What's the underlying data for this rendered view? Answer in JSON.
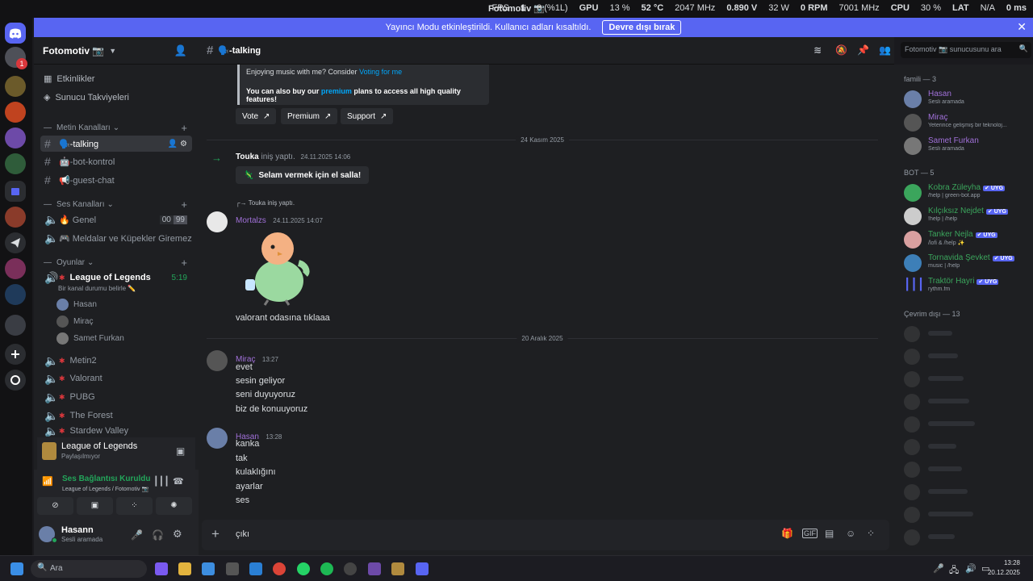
{
  "window": {
    "title": "Fotomotiv 📷",
    "stats": [
      "FPS",
      "1",
      "0 (%1L)",
      "GPU",
      "13 %",
      "52 °C",
      "2047 MHz",
      "0.890 V",
      "32 W",
      "0 RPM",
      "7001 MHz",
      "CPU",
      "30 %",
      "LAT",
      "N/A",
      "0 ms"
    ]
  },
  "banner": {
    "text": "Yayıncı Modu etkinleştirildi. Kullanıcı adları kısaltıldı.",
    "button": "Devre dışı bırak"
  },
  "rail": {
    "badge": "1"
  },
  "sidebar": {
    "guild_name": "Fotomotiv 📷",
    "nav": [
      "Etkinlikler",
      "Sunucu Takviyeleri"
    ],
    "text_category": "Metin Kanalları",
    "text_channels": [
      "🗣️-talking",
      "🤖-bot-kontrol",
      "📢-guest-chat"
    ],
    "voice_category": "Ses Kanalları",
    "voice_channels": [
      {
        "name": "🔥 Genel",
        "badge1": "00",
        "badge2": "99"
      },
      {
        "name": "🎮 Meldalar ve Küpekler Giremez"
      }
    ],
    "games_category": "Oyunlar",
    "active_channel": {
      "name": "League of Legends",
      "time": "5:19",
      "status": "Bir kanal durumu belirle ✏️"
    },
    "voice_members": [
      "Hasan",
      "Miraç",
      "Samet Furkan"
    ],
    "game_channels": [
      "Metin2",
      "Valorant",
      "PUBG",
      "The Forest",
      "Stardew Valley"
    ]
  },
  "activity": {
    "title": "League of Legends",
    "subtitle": "Paylaşılmıyor"
  },
  "voice": {
    "status": "Ses Bağlantısı Kuruldu",
    "location": "League of Legends / Fotomotiv 📷"
  },
  "user": {
    "name": "Hasann",
    "status": "Sesli aramada"
  },
  "chat": {
    "channel": "🗣️-talking",
    "embed": {
      "line1_prefix": "Enjoying music with me? Consider ",
      "line1_link": "Voting for me",
      "line2_prefix": "You can also buy our ",
      "line2_link": "premium",
      "line2_suffix": " plans to access all high quality features!",
      "buttons": [
        "Vote",
        "Premium",
        "Support"
      ]
    },
    "divider1": "24 Kasım 2025",
    "join_user": "Touka",
    "join_text": "iniş yaptı.",
    "join_time": "24.11.2025 14:06",
    "wave_button": "Selam vermek için el salla!",
    "reply_ref": "Touka iniş yaptı.",
    "msg1_user": "Mortalzs",
    "msg1_time": "24.11.2025 14:07",
    "msg1_text": "valorant odasına tıklaaa",
    "divider2": "20 Aralık 2025",
    "msg2_user": "Miraç",
    "msg2_time": "13:27",
    "msg2_lines": [
      "evet",
      "sesin geliyor",
      "seni duyuyoruz",
      "biz de konuuyoruz"
    ],
    "msg3_user": "Hasan",
    "msg3_time": "13:28",
    "msg3_lines": [
      "kanka",
      "tak",
      "kulaklığını",
      "ayarlar",
      "ses"
    ],
    "input_value": "çıkı"
  },
  "search": {
    "placeholder": "Fotomotiv 📷 sunucusunu ara"
  },
  "members": {
    "cat1": "famili — 3",
    "group1": [
      {
        "name": "Hasan",
        "sub": "Sesli aramada"
      },
      {
        "name": "Miraç",
        "sub": "Yeterince gelişmiş bir teknoloj..."
      },
      {
        "name": "Samet Furkan",
        "sub": "Sesli aramada"
      }
    ],
    "cat2": "BOT — 5",
    "bots": [
      {
        "name": "Kobra Züleyha",
        "tag": "✔ UYG",
        "sub": "/help | green-bot.app"
      },
      {
        "name": "Kılçıksız Nejdet",
        "tag": "✔ UYG",
        "sub": "!help | /help"
      },
      {
        "name": "Tanker Nejla",
        "tag": "✔ UYG",
        "sub": "/lofi & /help ✨"
      },
      {
        "name": "Tornavida Şevket",
        "tag": "✔ UYG",
        "sub": "music | /help"
      },
      {
        "name": "Traktör Hayri",
        "tag": "✔ UYG",
        "sub": "rythm.fm"
      }
    ],
    "cat3": "Çevrim dışı — 13"
  },
  "taskbar": {
    "search": "Ara",
    "time": "13:28",
    "date": "20.12.2025"
  },
  "colors": {
    "accent": "#5865f2",
    "username": "#a070d8",
    "online": "#23a55a",
    "bot_green": "#3ba55c"
  }
}
